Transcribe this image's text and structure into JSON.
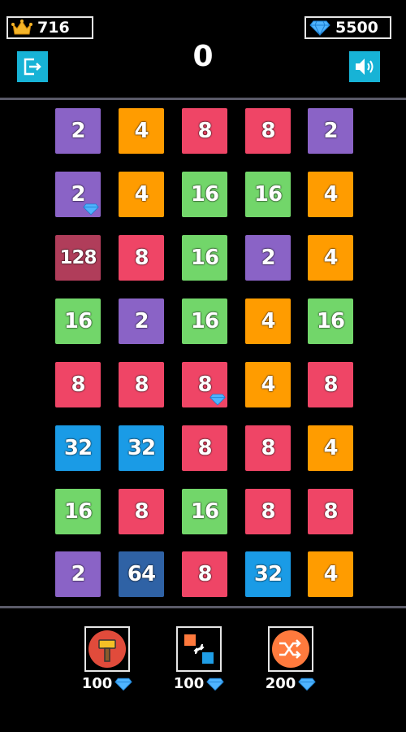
{
  "header": {
    "best_score": "716",
    "gems": "5500",
    "score": "0"
  },
  "colors": {
    "2": "#8a63c6",
    "4": "#ff9c00",
    "8": "#ef4566",
    "16": "#72d66a",
    "32": "#1a9be6",
    "64": "#2f62a5",
    "128": "#b03d5a",
    "button": "#17b3d6",
    "gem": "#4fb4ff",
    "crown": "#f5b428"
  },
  "board": {
    "rows": [
      [
        "2",
        "4",
        "8",
        "8",
        "2"
      ],
      [
        "2",
        "4",
        "16",
        "16",
        "4"
      ],
      [
        "128",
        "8",
        "16",
        "2",
        "4"
      ],
      [
        "16",
        "2",
        "16",
        "4",
        "16"
      ],
      [
        "8",
        "8",
        "8",
        "4",
        "8"
      ],
      [
        "32",
        "32",
        "8",
        "8",
        "4"
      ],
      [
        "16",
        "8",
        "16",
        "8",
        "8"
      ],
      [
        "2",
        "64",
        "8",
        "32",
        "4"
      ]
    ],
    "gem_tiles": [
      [
        1,
        0
      ],
      [
        4,
        2
      ]
    ]
  },
  "boosters": [
    {
      "name": "hammer-booster",
      "icon": "hammer-icon",
      "cost": "100"
    },
    {
      "name": "swap-booster",
      "icon": "swap-icon",
      "cost": "100"
    },
    {
      "name": "shuffle-booster",
      "icon": "shuffle-icon",
      "cost": "200"
    }
  ]
}
